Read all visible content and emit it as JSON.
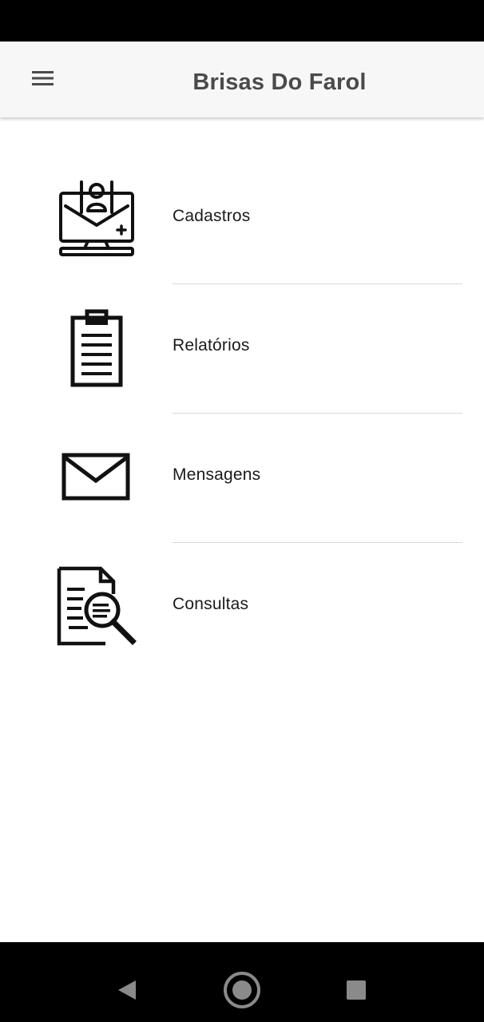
{
  "app_bar": {
    "title": "Brisas Do Farol",
    "menu_icon": "hamburger-menu-icon"
  },
  "menu_items": [
    {
      "label": "Cadastros",
      "icon": "computer-user-registration-icon"
    },
    {
      "label": "Relatórios",
      "icon": "clipboard-report-icon"
    },
    {
      "label": "Mensagens",
      "icon": "envelope-icon"
    },
    {
      "label": "Consultas",
      "icon": "document-search-icon"
    }
  ],
  "system_nav": {
    "back_icon": "back-triangle-icon",
    "home_icon": "home-circle-icon",
    "recents_icon": "recents-square-icon"
  },
  "colors": {
    "app_bar_bg": "#f7f7f7",
    "title_text": "#4a4a4a",
    "label_text": "#1a1a1a",
    "divider": "#d9d9d9",
    "system_bars": "#000000"
  }
}
